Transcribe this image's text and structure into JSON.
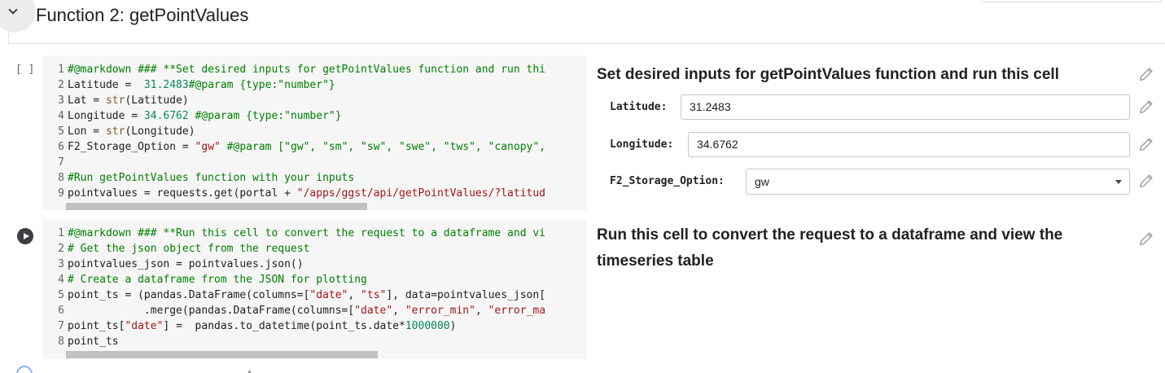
{
  "section": {
    "title": "Function 2: getPointValues",
    "toggle_icon": "chevron-down-icon"
  },
  "cell1": {
    "status": "[ ]",
    "code": [
      {
        "n": "1",
        "parts": [
          {
            "t": "#@markdown ### **Set desired inputs for getPointValues function and run thi",
            "c": "tk-com"
          }
        ]
      },
      {
        "n": "2",
        "parts": [
          {
            "t": "Latitude =  ",
            "c": ""
          },
          {
            "t": "31.2483",
            "c": "tk-num"
          },
          {
            "t": "#@param {type:\"number\"}",
            "c": "tk-com"
          }
        ]
      },
      {
        "n": "3",
        "parts": [
          {
            "t": "Lat = ",
            "c": ""
          },
          {
            "t": "str",
            "c": "tk-fn"
          },
          {
            "t": "(Latitude)",
            "c": ""
          }
        ]
      },
      {
        "n": "4",
        "parts": [
          {
            "t": "Longitude = ",
            "c": ""
          },
          {
            "t": "34.6762",
            "c": "tk-num"
          },
          {
            "t": " #@param {type:\"number\"}",
            "c": "tk-com"
          }
        ]
      },
      {
        "n": "5",
        "parts": [
          {
            "t": "Lon = ",
            "c": ""
          },
          {
            "t": "str",
            "c": "tk-fn"
          },
          {
            "t": "(Longitude)",
            "c": ""
          }
        ]
      },
      {
        "n": "6",
        "parts": [
          {
            "t": "F2_Storage_Option = ",
            "c": ""
          },
          {
            "t": "\"gw\"",
            "c": "tk-str"
          },
          {
            "t": " #@param [\"gw\", \"sm\", \"sw\", \"swe\", \"tws\", \"canopy\",",
            "c": "tk-com"
          }
        ]
      },
      {
        "n": "7",
        "parts": []
      },
      {
        "n": "8",
        "parts": [
          {
            "t": "#Run getPointValues function with your inputs",
            "c": "tk-com"
          }
        ]
      },
      {
        "n": "9",
        "parts": [
          {
            "t": "pointvalues = requests.get(portal + ",
            "c": ""
          },
          {
            "t": "\"/apps/ggst/api/getPointValues/?latitud",
            "c": "tk-str"
          }
        ]
      }
    ],
    "form": {
      "title": "Set desired inputs for getPointValues function and run this cell",
      "latitude_label": "Latitude:",
      "latitude_value": "31.2483",
      "longitude_label": "Longitude:",
      "longitude_value": "34.6762",
      "storage_label": "F2_Storage_Option:",
      "storage_value": "gw"
    }
  },
  "cell2": {
    "run_icon": "play-icon",
    "code": [
      {
        "n": "1",
        "parts": [
          {
            "t": "#@markdown ### **Run this cell to convert the request to a dataframe and vi",
            "c": "tk-com"
          }
        ]
      },
      {
        "n": "2",
        "parts": [
          {
            "t": "# Get the json object from the request",
            "c": "tk-com"
          }
        ]
      },
      {
        "n": "3",
        "parts": [
          {
            "t": "pointvalues_json = pointvalues.json()",
            "c": ""
          }
        ]
      },
      {
        "n": "4",
        "parts": [
          {
            "t": "# Create a dataframe from the JSON for plotting",
            "c": "tk-com"
          }
        ]
      },
      {
        "n": "5",
        "parts": [
          {
            "t": "point_ts = (pandas.DataFrame(columns=[",
            "c": ""
          },
          {
            "t": "\"date\"",
            "c": "tk-str"
          },
          {
            "t": ", ",
            "c": ""
          },
          {
            "t": "\"ts\"",
            "c": "tk-str"
          },
          {
            "t": "], data=pointvalues_json[",
            "c": ""
          }
        ]
      },
      {
        "n": "6",
        "parts": [
          {
            "t": "            .merge(pandas.DataFrame(columns=[",
            "c": ""
          },
          {
            "t": "\"date\"",
            "c": "tk-str"
          },
          {
            "t": ", ",
            "c": ""
          },
          {
            "t": "\"error_min\"",
            "c": "tk-str"
          },
          {
            "t": ", ",
            "c": ""
          },
          {
            "t": "\"error_ma",
            "c": "tk-str"
          }
        ]
      },
      {
        "n": "7",
        "parts": [
          {
            "t": "point_ts[",
            "c": ""
          },
          {
            "t": "\"date\"",
            "c": "tk-str"
          },
          {
            "t": "] =  pandas.to_datetime(point_ts.date*",
            "c": ""
          },
          {
            "t": "1000000",
            "c": "tk-num"
          },
          {
            "t": ")",
            "c": ""
          }
        ]
      },
      {
        "n": "8",
        "parts": [
          {
            "t": "point_ts",
            "c": ""
          }
        ]
      }
    ],
    "form": {
      "title": "Run this cell to convert the request to a dataframe and view the timeseries table"
    }
  },
  "icons": {
    "edit": "pencil-icon"
  }
}
